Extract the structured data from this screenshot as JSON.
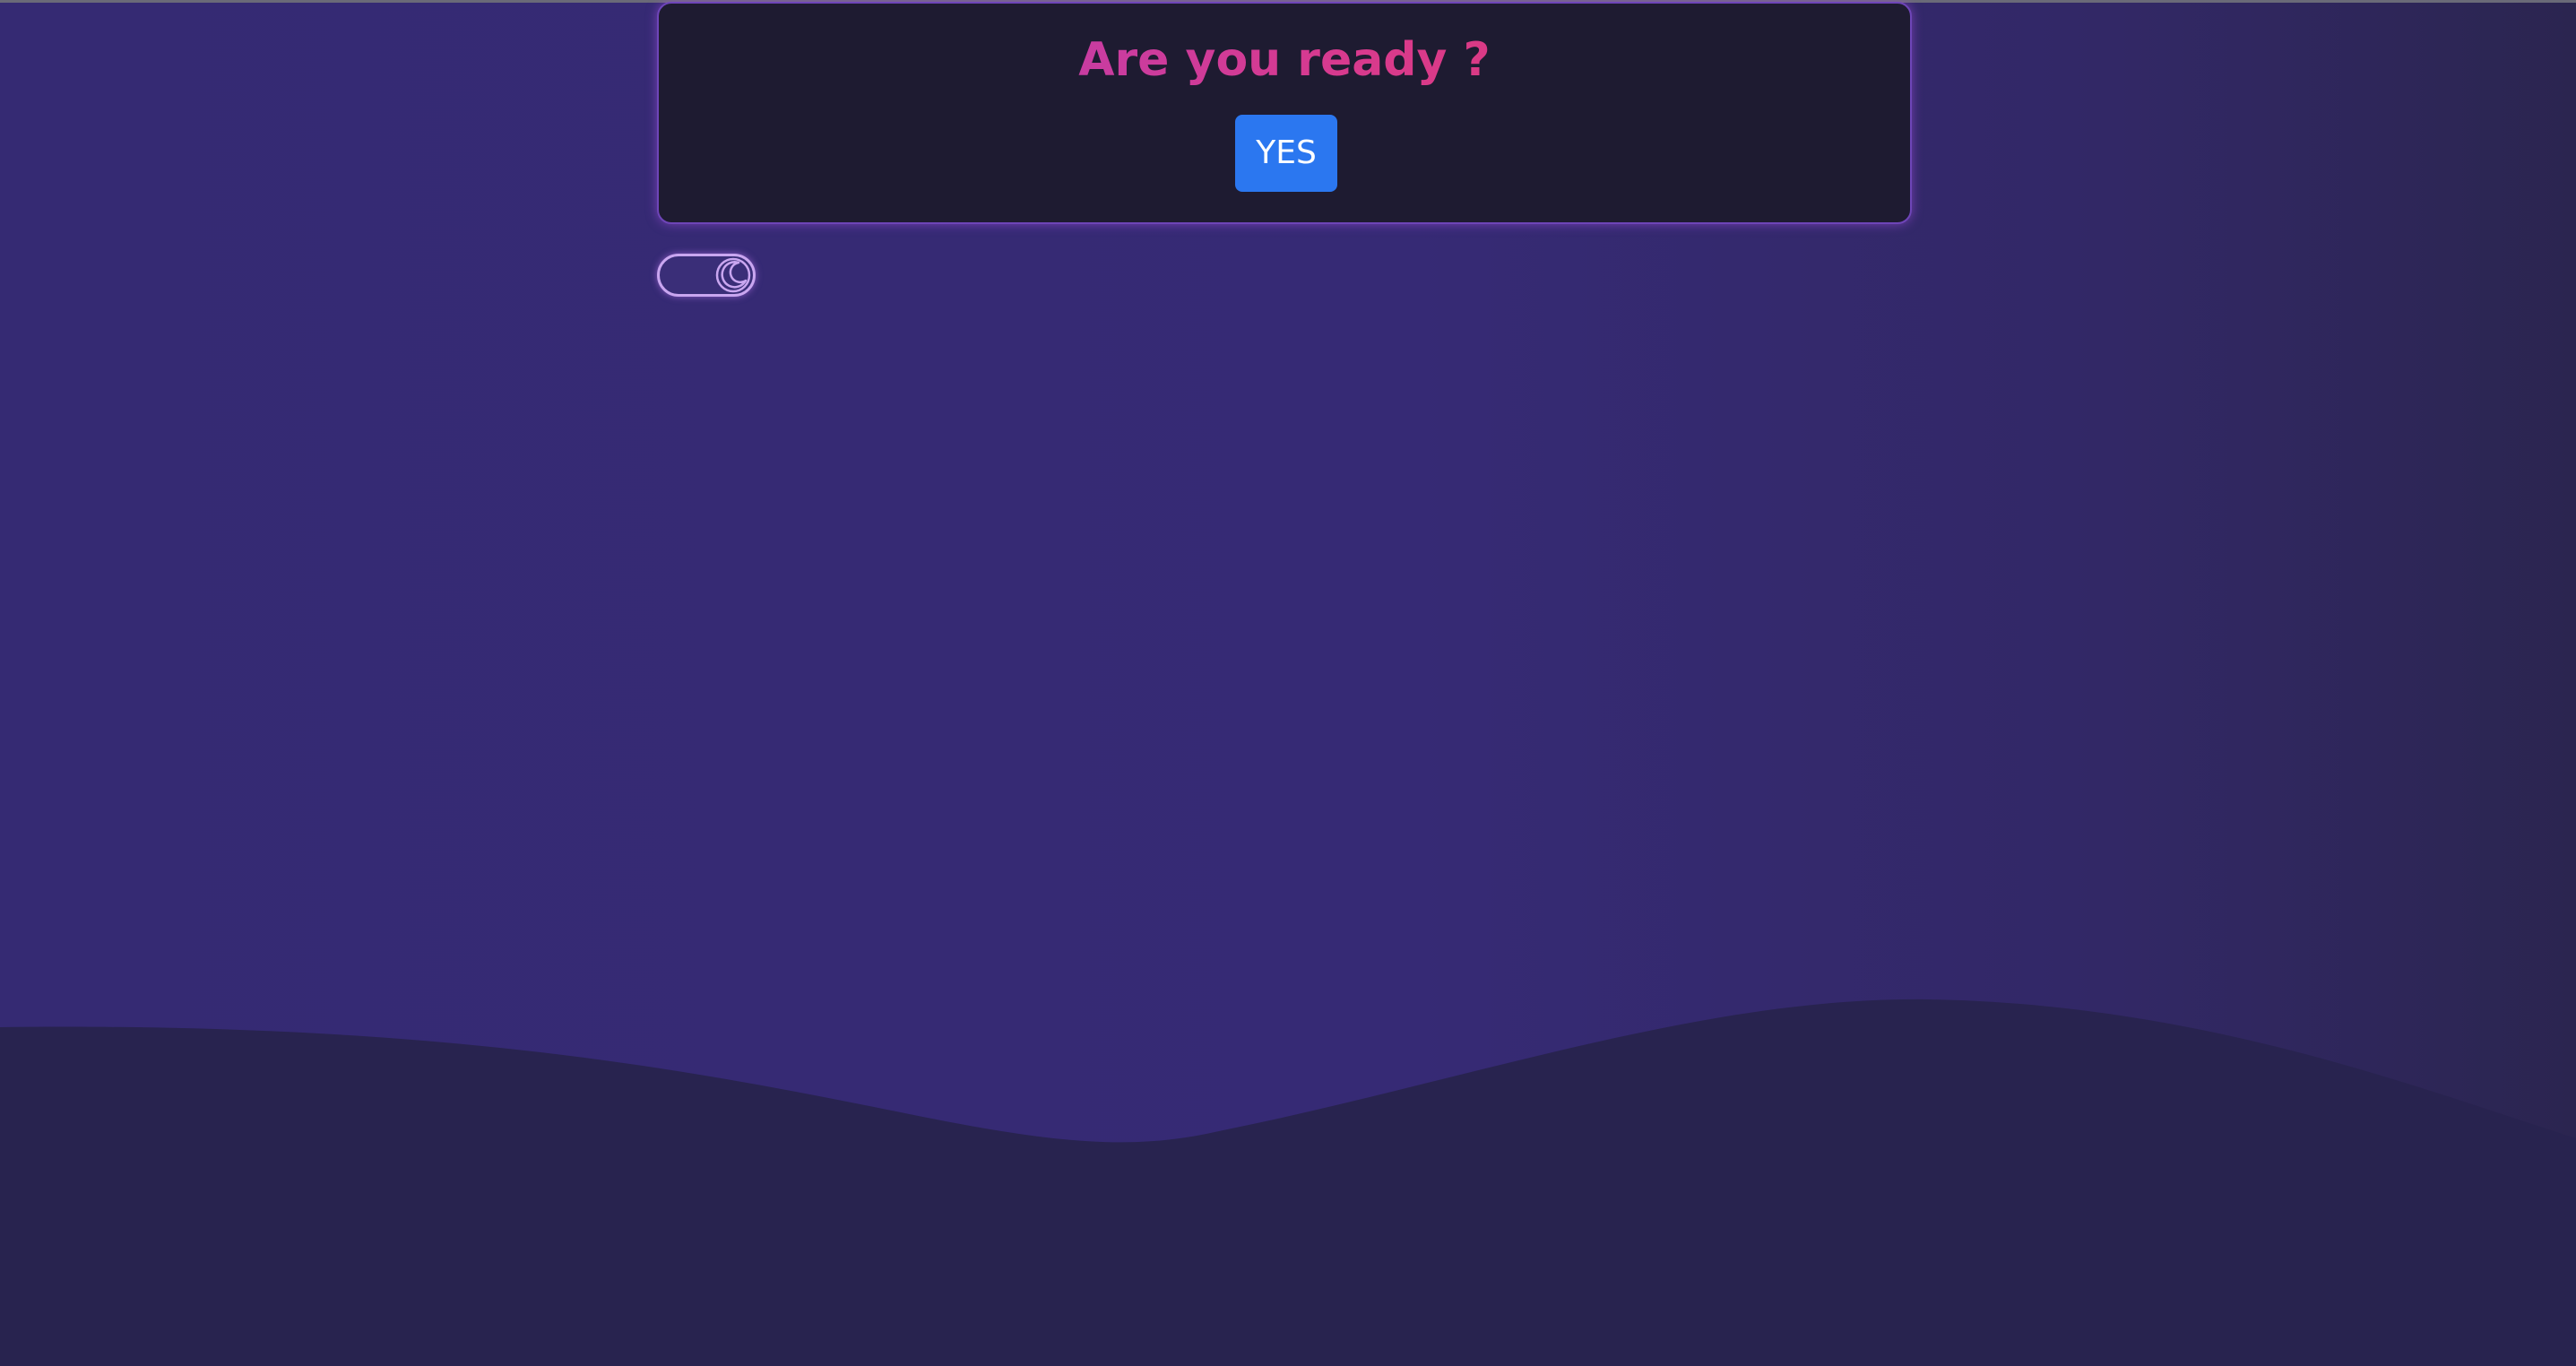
{
  "dialog": {
    "title": "Are you ready ?",
    "confirm_label": "YES"
  },
  "theme_toggle": {
    "icon": "moon-icon",
    "state": "dark"
  },
  "colors": {
    "background": "#362a75",
    "wave": "#28234f",
    "dialog_bg": "#1e1b31",
    "dialog_border": "#6e45b8",
    "title_gradient_start": "#b03fbf",
    "title_gradient_end": "#e23a6c",
    "button_bg": "#2b77f0",
    "toggle_border": "#c9a6f0"
  }
}
